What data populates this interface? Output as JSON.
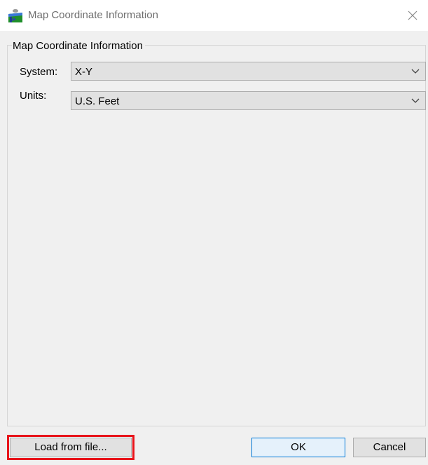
{
  "window": {
    "title": "Map Coordinate Information",
    "icon": "map-app-icon",
    "close_icon": "close-icon"
  },
  "group": {
    "title": "Map Coordinate Information",
    "system": {
      "label": "System:",
      "value": "X-Y"
    },
    "units": {
      "label": "Units:",
      "value": "U.S. Feet"
    }
  },
  "buttons": {
    "load_label": "Load from file...",
    "ok_label": "OK",
    "cancel_label": "Cancel"
  },
  "colors": {
    "highlight": "#e8141b",
    "default_button_border": "#0078d7"
  }
}
